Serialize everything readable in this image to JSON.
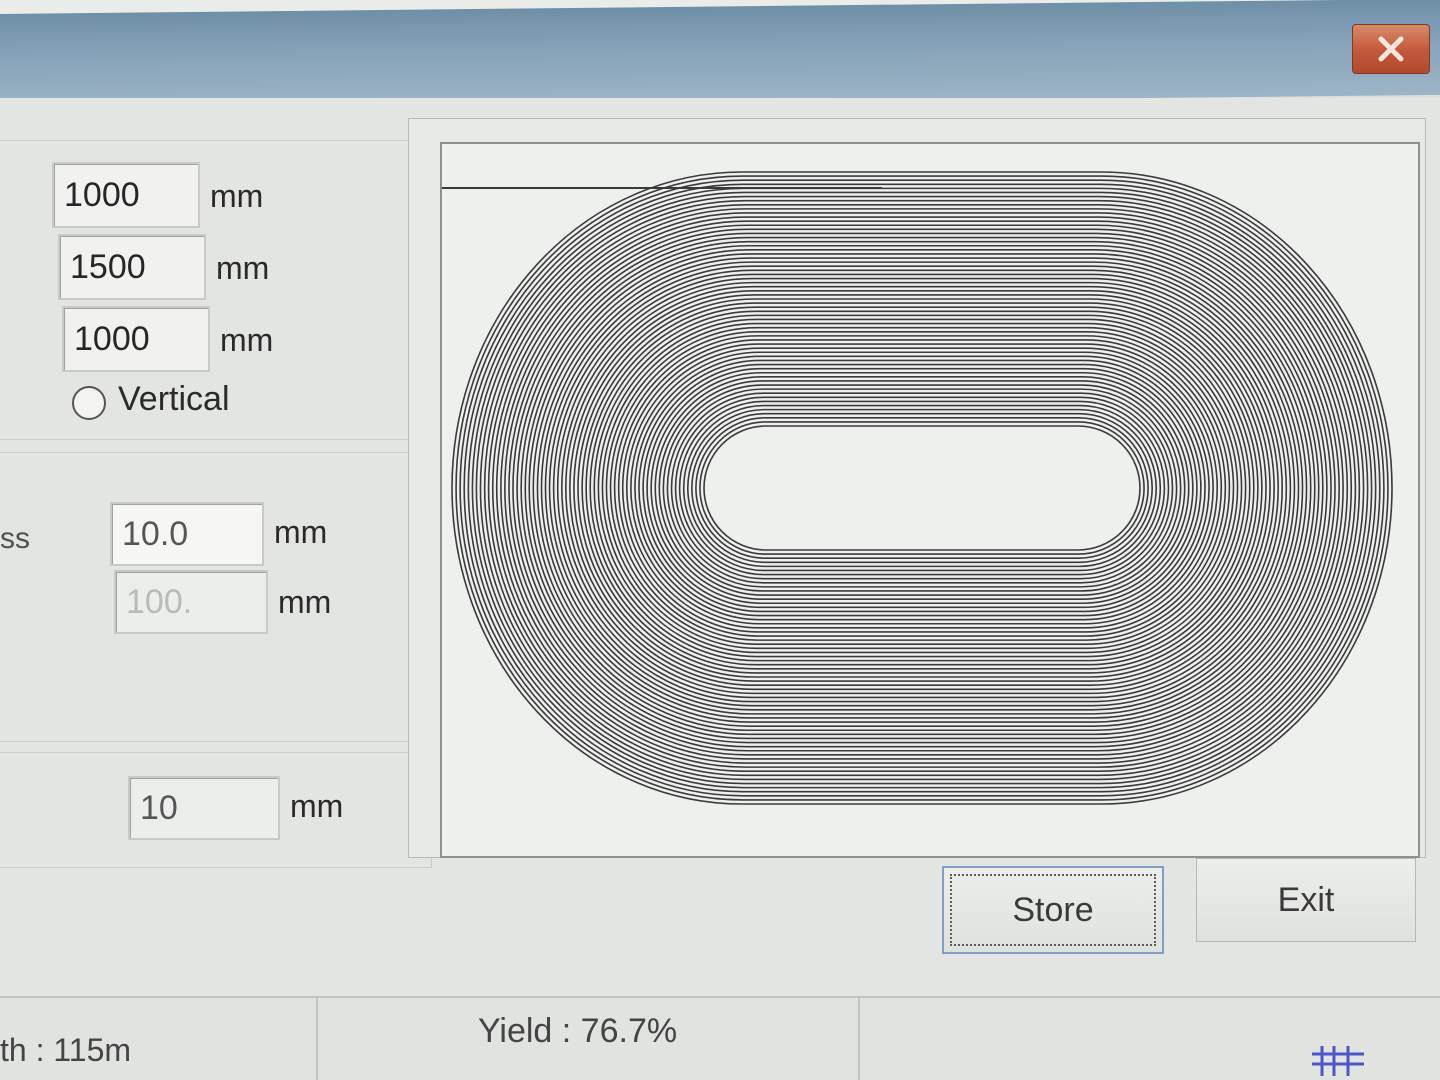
{
  "window": {
    "close_icon": "close-icon"
  },
  "params": {
    "field1_value": "1000",
    "field1_unit": "mm",
    "field2_value": "1500",
    "field2_unit": "mm",
    "field3_value": "1000",
    "field3_unit": "mm",
    "orientation_label": "Vertical",
    "orientation_selected": false
  },
  "cutting": {
    "partial_label": "ss",
    "spacing_value": "10.0",
    "spacing_unit": "mm",
    "disabled_value": "100.",
    "disabled_unit": "mm"
  },
  "offset": {
    "value": "10",
    "unit": "mm"
  },
  "buttons": {
    "store_label": "Store",
    "exit_label": "Exit"
  },
  "status": {
    "length_text": "th : 115m",
    "yield_text": "Yield : 76.7%"
  },
  "colors": {
    "titlebar": "#7f9cb3",
    "close_button": "#c4573a",
    "toolpath": "#3a3a3a",
    "focus_border": "#7ea0c6"
  }
}
